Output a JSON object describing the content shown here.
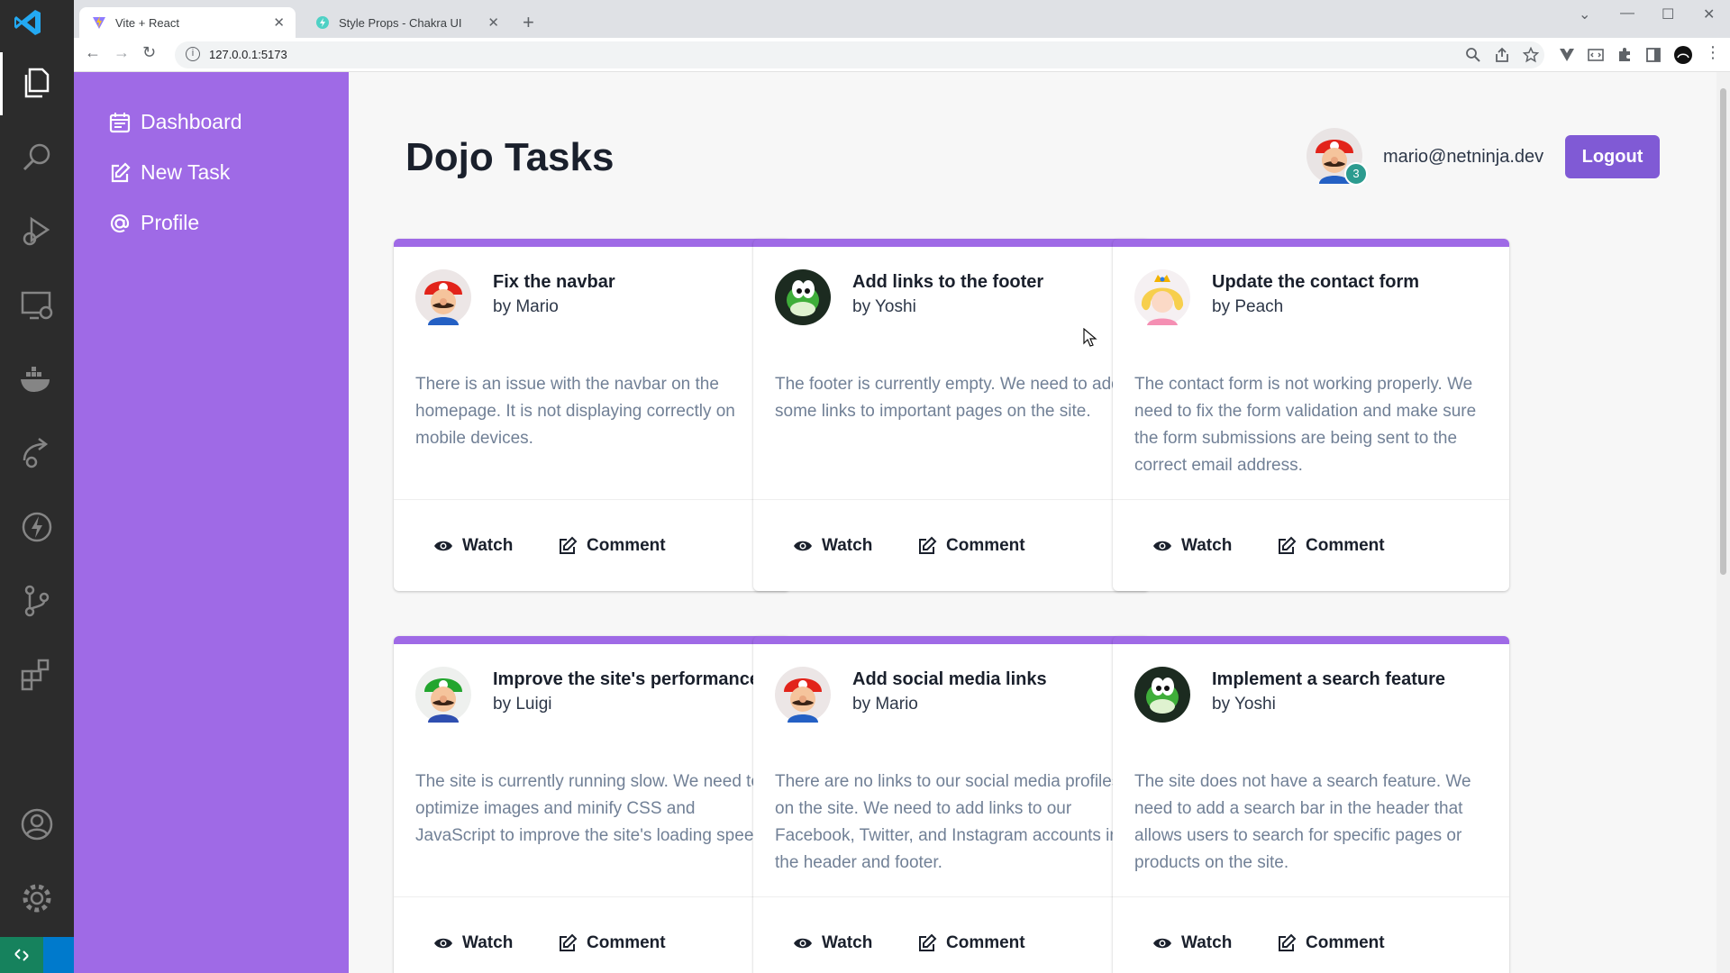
{
  "browser": {
    "tabs": [
      {
        "label": "Vite + React",
        "active": true
      },
      {
        "label": "Style Props - Chakra UI",
        "active": false
      }
    ],
    "url": "127.0.0.1:5173"
  },
  "sidebar": {
    "items": [
      {
        "label": "Dashboard",
        "icon": "calendar-icon"
      },
      {
        "label": "New Task",
        "icon": "edit-icon"
      },
      {
        "label": "Profile",
        "icon": "at-icon"
      }
    ]
  },
  "header": {
    "title": "Dojo Tasks",
    "email": "mario@netninja.dev",
    "badge_count": "3",
    "logout_label": "Logout"
  },
  "actions": {
    "watch_label": "Watch",
    "comment_label": "Comment"
  },
  "tasks": [
    {
      "title": "Fix the navbar",
      "author": "by Mario",
      "avatar": "mario",
      "description": "There is an issue with the navbar on the homepage. It is not displaying correctly on mobile devices."
    },
    {
      "title": "Add links to the footer",
      "author": "by Yoshi",
      "avatar": "yoshi",
      "description": "The footer is currently empty. We need to add some links to important pages on the site."
    },
    {
      "title": "Update the contact form",
      "author": "by Peach",
      "avatar": "peach",
      "description": "The contact form is not working properly. We need to fix the form validation and make sure the form submissions are being sent to the correct email address."
    },
    {
      "title": "Improve the site's performance",
      "author": "by Luigi",
      "avatar": "luigi",
      "description": "The site is currently running slow. We need to optimize images and minify CSS and JavaScript to improve the site's loading speed."
    },
    {
      "title": "Add social media links",
      "author": "by Mario",
      "avatar": "mario",
      "description": "There are no links to our social media profiles on the site. We need to add links to our Facebook, Twitter, and Instagram accounts in the header and footer."
    },
    {
      "title": "Implement a search feature",
      "author": "by Yoshi",
      "avatar": "yoshi",
      "description": "The site does not have a search feature. We need to add a search bar in the header that allows users to search for specific pages or products on the site."
    }
  ],
  "colors": {
    "sidebar": "#9f6ae6",
    "logout": "#805ad5",
    "card_accent": "#9f6ae6",
    "badge": "#2c9b8f"
  }
}
